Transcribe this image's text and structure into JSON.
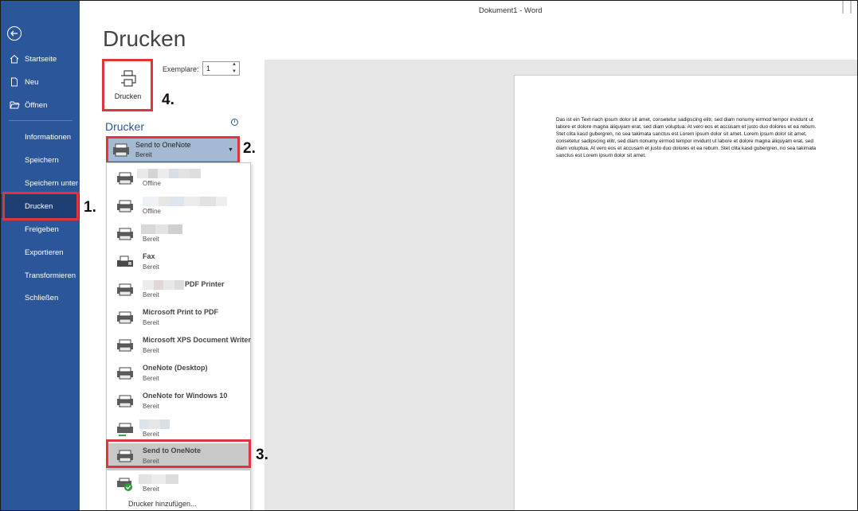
{
  "window": {
    "title": "Dokument1  -  Word"
  },
  "sidebar": {
    "items": [
      {
        "label": "Startseite",
        "icon": "home-icon"
      },
      {
        "label": "Neu",
        "icon": "new-document-icon"
      },
      {
        "label": "Öffnen",
        "icon": "folder-open-icon"
      },
      {
        "label": "Informationen"
      },
      {
        "label": "Speichern"
      },
      {
        "label": "Speichern unter"
      },
      {
        "label": "Drucken",
        "active": true
      },
      {
        "label": "Freigeben"
      },
      {
        "label": "Exportieren"
      },
      {
        "label": "Transformieren"
      },
      {
        "label": "Schließen"
      }
    ]
  },
  "steps": {
    "s1": "1.",
    "s2": "2.",
    "s3": "3.",
    "s4": "4."
  },
  "print": {
    "title": "Drucken",
    "button_label": "Drucken",
    "copies_label": "Exemplare:",
    "copies_value": "1",
    "printer_section": "Drucker",
    "info_icon": "i",
    "selected_printer": {
      "name": "Send to OneNote",
      "status": "Bereit"
    },
    "printers": [
      {
        "name": "",
        "status": "Offline"
      },
      {
        "name": "",
        "status": "Offline"
      },
      {
        "name": "",
        "status": "Bereit"
      },
      {
        "name": "Fax",
        "status": "Bereit"
      },
      {
        "name": "PDF Printer",
        "status": "Bereit"
      },
      {
        "name": "Microsoft Print to PDF",
        "status": "Bereit"
      },
      {
        "name": "Microsoft XPS Document Writer",
        "status": "Bereit"
      },
      {
        "name": "OneNote (Desktop)",
        "status": "Bereit"
      },
      {
        "name": "OneNote for Windows 10",
        "status": "Bereit"
      },
      {
        "name": "",
        "status": "Bereit"
      },
      {
        "name": "Send to OneNote",
        "status": "Bereit",
        "selected": true
      },
      {
        "name": "",
        "status": "Bereit"
      }
    ],
    "add_printer": "Drucker hinzufügen..."
  },
  "preview": {
    "text": "Das ist ein Text nach ipsum dolor sit amet, consetetur sadipscing elitr, sed diam nonumy eirmod tempor invidunt ut labore et dolore magna aliquyam erat, sed diam voluptua. At vero eos et accusam et justo duo dolores et ea rebum. Stet clita kasd gubergren, no sea takimata sanctus est Lorem ipsum dolor sit amet. Lorem ipsum dolor sit amet, consetetur sadipscing elitr, sed diam nonumy eirmod tempor invidunt ut labore et dolore magna aliquyam erat, sed diam voluptua. At vero eos et accusam et justo duo dolores et ea rebum. Stet clita kasd gubergren, no sea takimata sanctus est Lorem ipsum dolor sit amet."
  }
}
